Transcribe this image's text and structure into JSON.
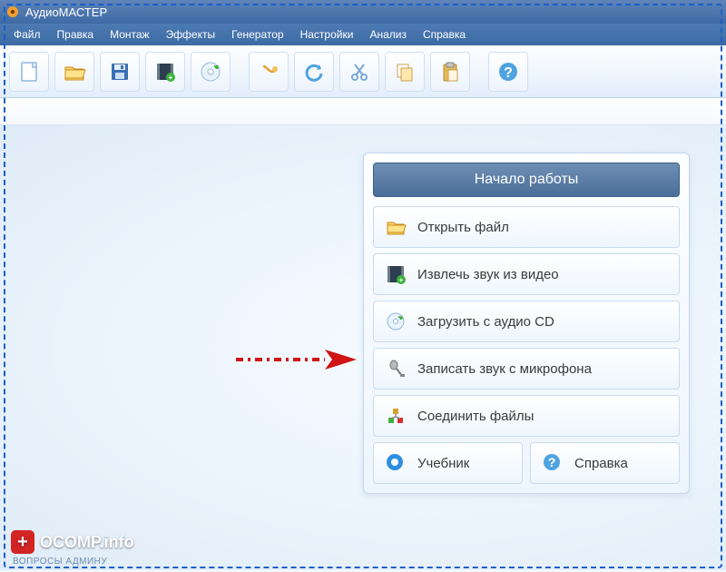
{
  "titlebar": {
    "title": "АудиоМАСТЕР"
  },
  "menu": {
    "items": [
      "Файл",
      "Правка",
      "Монтаж",
      "Эффекты",
      "Генератор",
      "Настройки",
      "Анализ",
      "Справка"
    ]
  },
  "toolbar": {
    "icons": [
      "new",
      "open",
      "save",
      "video-extract",
      "cd-import",
      "effects",
      "undo",
      "cut",
      "copy",
      "paste",
      "help"
    ]
  },
  "start_panel": {
    "title": "Начало работы",
    "options": [
      {
        "icon": "folder",
        "label": "Открыть файл"
      },
      {
        "icon": "video",
        "label": "Извлечь звук из видео"
      },
      {
        "icon": "cd",
        "label": "Загрузить с аудио CD"
      },
      {
        "icon": "mic",
        "label": "Записать звук с микрофона"
      },
      {
        "icon": "merge",
        "label": "Соединить файлы"
      }
    ],
    "bottom": [
      {
        "icon": "book",
        "label": "Учебник"
      },
      {
        "icon": "help",
        "label": "Справка"
      }
    ]
  },
  "watermark": {
    "text": "OCOMP.info",
    "sub": "ВОПРОСЫ АДМИНУ"
  },
  "colors": {
    "accent": "#4571a7",
    "header_grad_top": "#6f8fb4",
    "header_grad_bot": "#4a6e99",
    "arrow": "#d11414"
  }
}
